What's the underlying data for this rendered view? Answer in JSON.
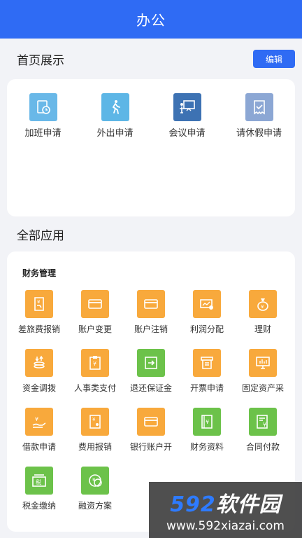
{
  "header": {
    "title": "办公"
  },
  "home": {
    "title": "首页展示",
    "edit_label": "编辑",
    "items": [
      {
        "label": "加班申请",
        "icon": "overtime-clock-icon",
        "color": "#69b8e8"
      },
      {
        "label": "外出申请",
        "icon": "walking-person-icon",
        "color": "#5db6e6"
      },
      {
        "label": "会议申请",
        "icon": "meeting-board-icon",
        "color": "#3d72b3"
      },
      {
        "label": "请休假申请",
        "icon": "leave-note-icon",
        "color": "#8ca7d4"
      }
    ]
  },
  "apps": {
    "title": "全部应用",
    "group_title": "财务管理",
    "items": [
      {
        "label": "差旅费报销",
        "icon": "travel-reimburse-icon",
        "color": "orange"
      },
      {
        "label": "账户变更",
        "icon": "card-icon",
        "color": "orange"
      },
      {
        "label": "账户注销",
        "icon": "card-icon",
        "color": "orange"
      },
      {
        "label": "利润分配",
        "icon": "profit-icon",
        "color": "orange"
      },
      {
        "label": "理财",
        "icon": "money-bag-icon",
        "color": "orange"
      },
      {
        "label": "资金调拨",
        "icon": "fund-transfer-icon",
        "color": "orange"
      },
      {
        "label": "人事类支付",
        "icon": "payment-doc-icon",
        "color": "orange"
      },
      {
        "label": "退还保证金",
        "icon": "refund-icon",
        "color": "green"
      },
      {
        "label": "开票申请",
        "icon": "invoice-icon",
        "color": "orange"
      },
      {
        "label": "固定资产采",
        "icon": "asset-monitor-icon",
        "color": "orange"
      },
      {
        "label": "借款申请",
        "icon": "loan-hand-icon",
        "color": "orange"
      },
      {
        "label": "费用报销",
        "icon": "expense-doc-icon",
        "color": "orange"
      },
      {
        "label": "银行账户开",
        "icon": "card-icon",
        "color": "orange"
      },
      {
        "label": "财务资料",
        "icon": "finance-file-icon",
        "color": "green"
      },
      {
        "label": "合同付款",
        "icon": "contract-icon",
        "color": "green"
      },
      {
        "label": "税金缴纳",
        "icon": "tax-icon",
        "color": "green"
      },
      {
        "label": "融资方案",
        "icon": "coins-icon",
        "color": "green"
      }
    ]
  },
  "watermark": {
    "brand_num": "592",
    "brand_text": "软件园",
    "url": "www.592xiazai.com"
  }
}
